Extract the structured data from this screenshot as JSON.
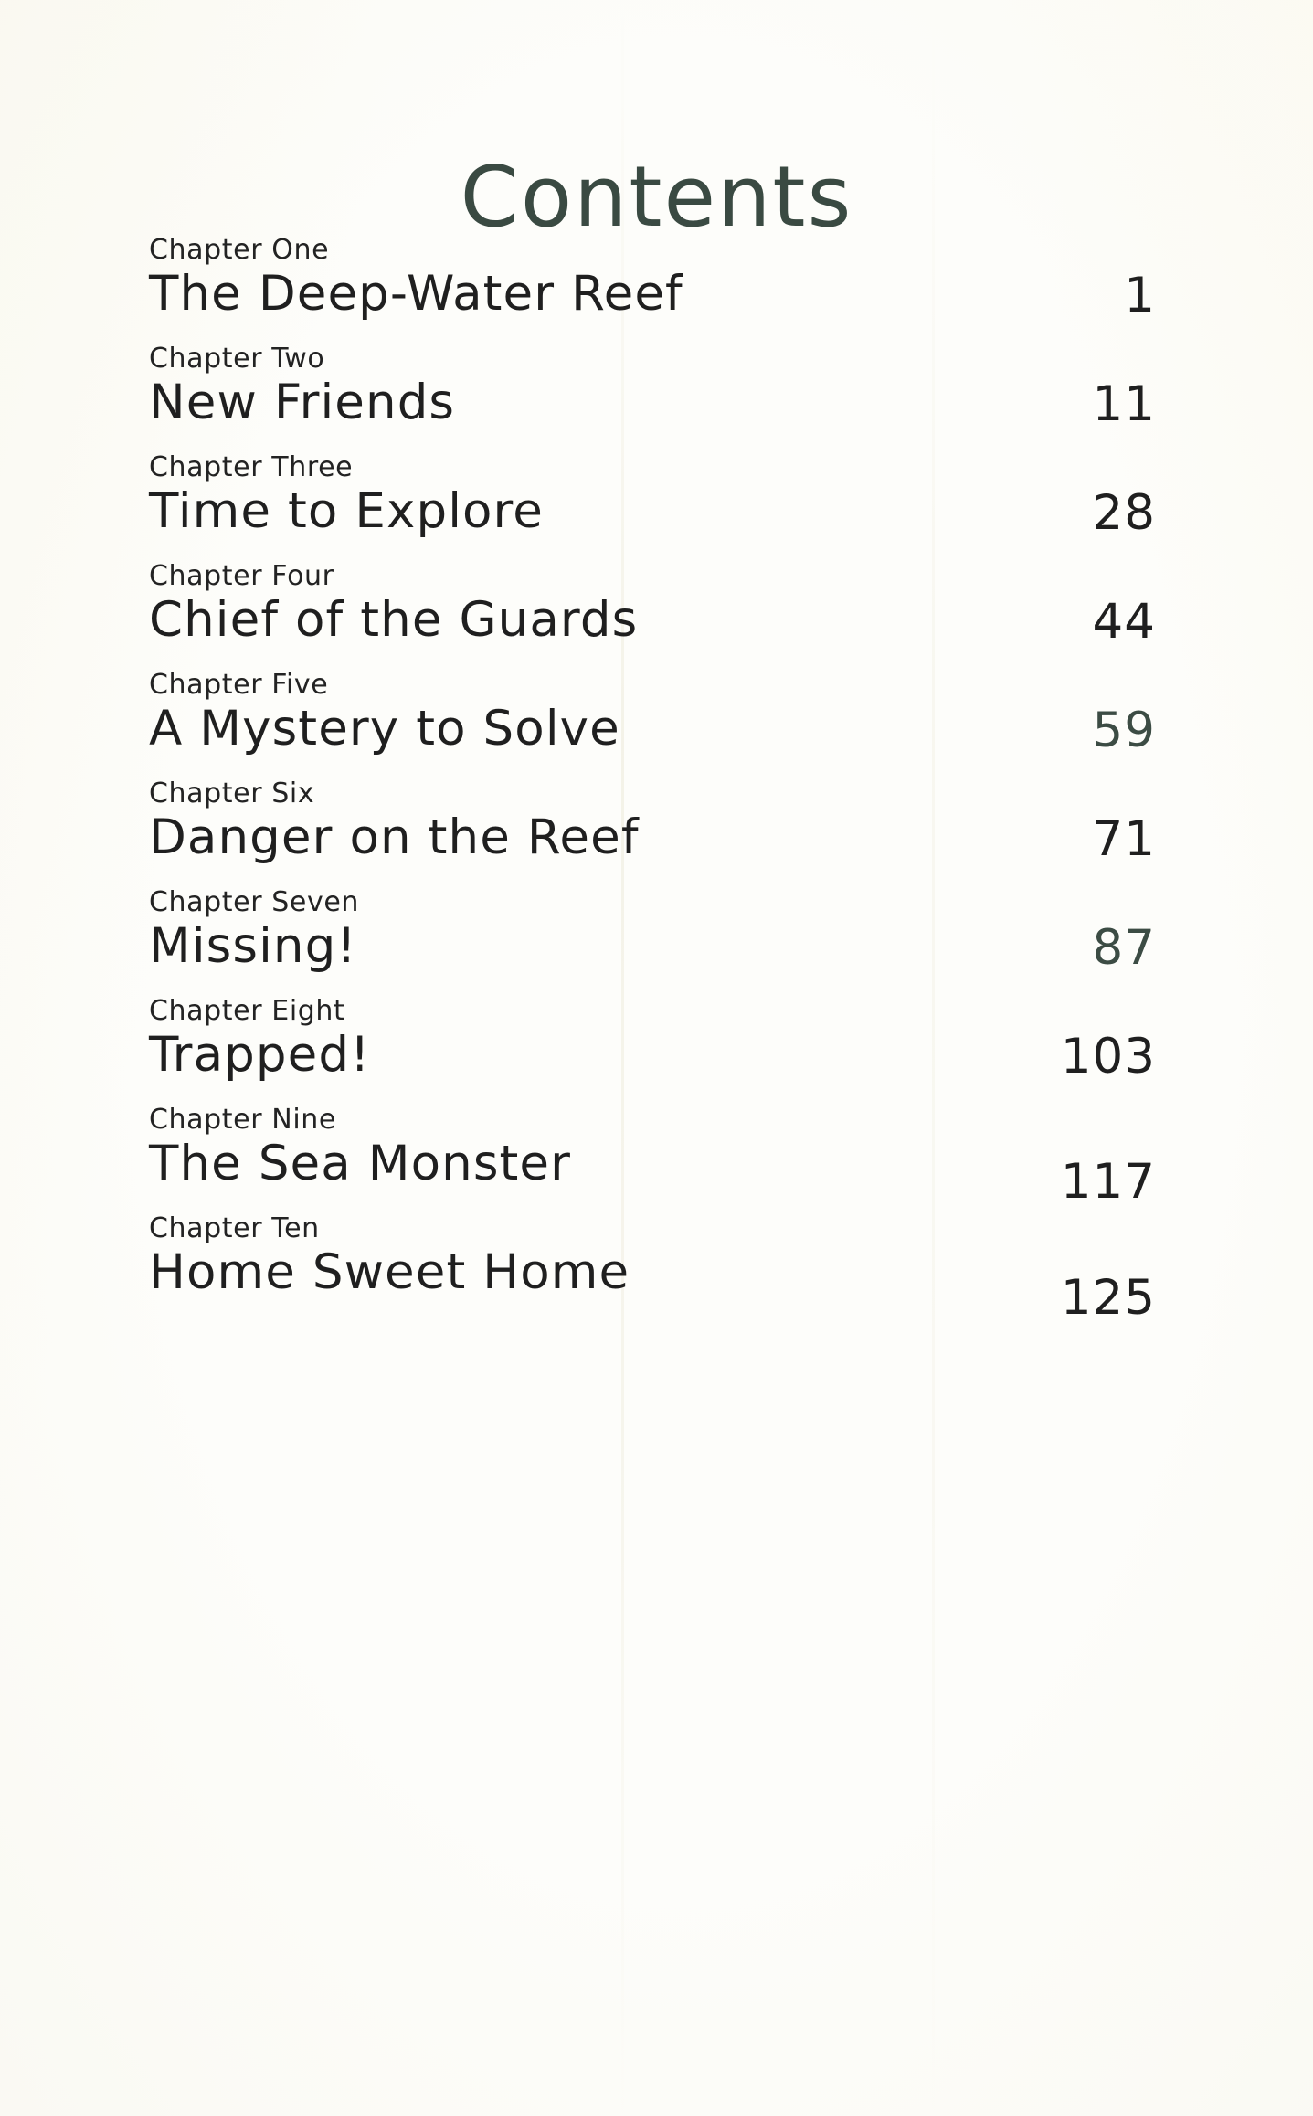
{
  "page": {
    "title": "Contents",
    "background_color": "#fdfdfa",
    "title_color": "#3a4a42",
    "body_text_color": "#1f1f1f",
    "accent_color": "#3c4c44"
  },
  "contents": {
    "entries": [
      {
        "label": "Chapter One",
        "title": "The Deep-Water Reef",
        "page": "1"
      },
      {
        "label": "Chapter Two",
        "title": "New Friends",
        "page": "11"
      },
      {
        "label": "Chapter Three",
        "title": "Time to Explore",
        "page": "28"
      },
      {
        "label": "Chapter Four",
        "title": "Chief of the Guards",
        "page": "44"
      },
      {
        "label": "Chapter Five",
        "title": "A Mystery to Solve",
        "page": "59"
      },
      {
        "label": "Chapter Six",
        "title": "Danger on the Reef",
        "page": "71"
      },
      {
        "label": "Chapter Seven",
        "title": "Missing!",
        "page": "87"
      },
      {
        "label": "Chapter Eight",
        "title": "Trapped!",
        "page": "103"
      },
      {
        "label": "Chapter Nine",
        "title": "The Sea Monster",
        "page": "117"
      },
      {
        "label": "Chapter Ten",
        "title": "Home Sweet Home",
        "page": "125"
      }
    ]
  }
}
